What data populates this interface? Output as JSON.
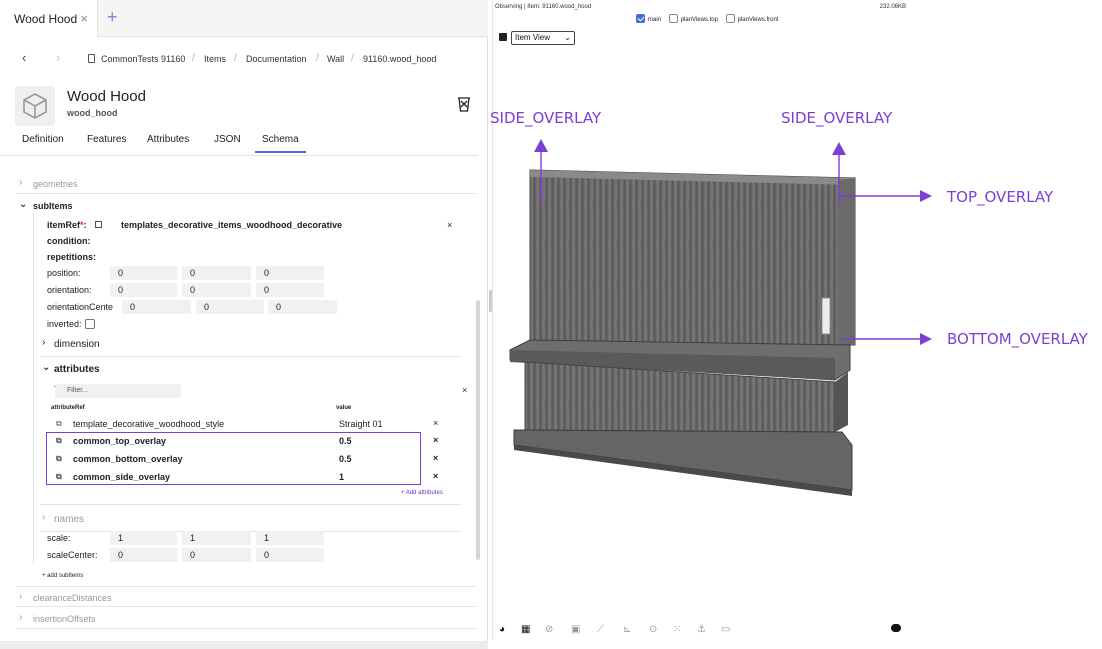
{
  "tab": {
    "label": "Wood Hood",
    "close": "×",
    "add": "+"
  },
  "breadcrumb": {
    "back": "‹",
    "forward": "›",
    "items": [
      "CommonTests 91160",
      "Items",
      "Documentation",
      "Wall",
      "91160.wood_hood"
    ],
    "sep": "/"
  },
  "item": {
    "title": "Wood Hood",
    "subtitle": "wood_hood"
  },
  "tabs": [
    "Definition",
    "Features",
    "Attributes",
    "JSON",
    "Schema"
  ],
  "active_tab": "Schema",
  "sections": {
    "geometries": "geometries",
    "subitems": "subItems",
    "clearance": "clearanceDistances",
    "insertion": "insertionOffsets"
  },
  "subitem": {
    "item_ref_label": "itemRef",
    "item_ref_value": "templates_decorative_items_woodhood_decorative",
    "condition_label": "condition:",
    "repetitions_label": "repetitions:",
    "position_label": "position:",
    "position": [
      "0",
      "0",
      "0"
    ],
    "orientation_label": "orientation:",
    "orientation": [
      "0",
      "0",
      "0"
    ],
    "orientation_center_label": "orientationCente",
    "orientation_center": [
      "0",
      "0",
      "0"
    ],
    "inverted_label": "inverted:",
    "dimension_label": "dimension",
    "attributes_label": "attributes",
    "filter_placeholder": "Filter...",
    "col_ref": "attributeRef",
    "col_value": "value",
    "attributes": [
      {
        "name": "template_decorative_woodhood_style",
        "value": "Straight 01"
      },
      {
        "name": "common_top_overlay",
        "value": "0.5"
      },
      {
        "name": "common_bottom_overlay",
        "value": "0.5"
      },
      {
        "name": "common_side_overlay",
        "value": "1"
      }
    ],
    "add_attributes": "+ Add attributes",
    "names_label": "names",
    "scale_label": "scale:",
    "scale": [
      "1",
      "1",
      "1"
    ],
    "scale_center_label": "scaleCenter:",
    "scale_center": [
      "0",
      "0",
      "0"
    ],
    "add_subitems": "+ add subItems"
  },
  "viewer": {
    "observing": "Observing | Item: 91160.wood_hood",
    "size": "232.06KB",
    "views": [
      "main",
      "planViews.top",
      "planViews.front"
    ],
    "view_mode": "Item View",
    "overlay_labels": {
      "side_left": "SIDE_OVERLAY",
      "side_right": "SIDE_OVERLAY",
      "top": "TOP_OVERLAY",
      "bottom": "BOTTOM_OVERLAY"
    }
  },
  "colors": {
    "accent": "#7b3fd4",
    "link_blue": "#3f6fd6",
    "wood": "#6f6f6f"
  }
}
